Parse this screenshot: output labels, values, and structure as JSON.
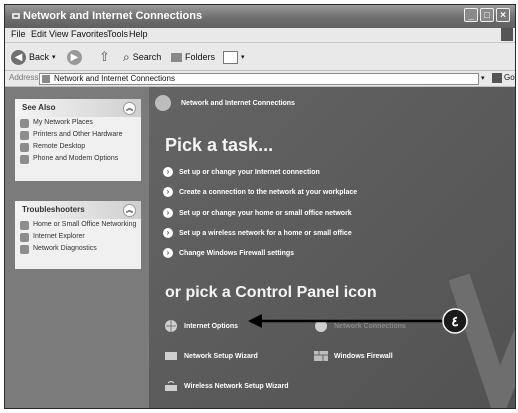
{
  "window": {
    "title": "Network and Internet Connections"
  },
  "menu": [
    "File",
    "Edit",
    "View",
    "Favorites",
    "Tools",
    "Help"
  ],
  "toolbar": {
    "back": "Back",
    "search": "Search",
    "folders": "Folders"
  },
  "address": {
    "label": "Address",
    "value": "Network and Internet Connections",
    "go": "Go"
  },
  "see_also": {
    "title": "See Also",
    "items": [
      "My Network Places",
      "Printers and Other Hardware",
      "Remote Desktop",
      "Phone and Modem Options"
    ]
  },
  "troubleshooters": {
    "title": "Troubleshooters",
    "items": [
      "Home or Small Office Networking",
      "Internet Explorer",
      "Network Diagnostics"
    ]
  },
  "main": {
    "header": "Network and Internet Connections",
    "pick_task": "Pick a task...",
    "tasks": [
      "Set up or change your Internet connection",
      "Create a connection to the network at your workplace",
      "Set up or change your home or small office network",
      "Set up a wireless network for a home or small office",
      "Change Windows Firewall settings"
    ],
    "pick_cp": "or pick a Control Panel icon",
    "cp_icons": [
      "Internet Options",
      "Network Connections",
      "Network Setup Wizard",
      "Windows Firewall",
      "Wireless Network Setup Wizard"
    ]
  },
  "callout": {
    "number": "٤"
  }
}
